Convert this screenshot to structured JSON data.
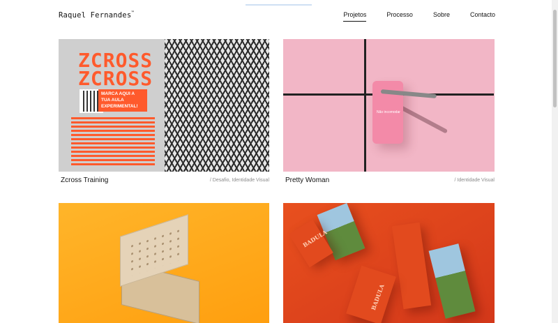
{
  "header": {
    "logo": "Raquel Fernandes",
    "logo_mark": "™",
    "nav": [
      {
        "label": "Projetos",
        "active": true
      },
      {
        "label": "Processo",
        "active": false
      },
      {
        "label": "Sobre",
        "active": false
      },
      {
        "label": "Contacto",
        "active": false
      }
    ]
  },
  "projects": [
    {
      "title": "Zcross Training",
      "tags": "/ Desafio, Identidade Visual",
      "image_text": {
        "word": "ZCROSS",
        "banner": "MARCA AQUI A TUA AULA EXPERIMENTAL!"
      }
    },
    {
      "title": "Pretty Woman",
      "tags": "/ Identidade Visual",
      "image_text": {
        "door_tag": "Não incomodar"
      }
    },
    {
      "title": "",
      "tags": "",
      "image_text": {}
    },
    {
      "title": "",
      "tags": "",
      "image_text": {
        "brand": "BADULA"
      }
    }
  ],
  "colors": {
    "accent_orange": "#ff5a2c",
    "pink": "#f2b6c6",
    "yellow": "#ffb52a",
    "red_orange": "#e8501e"
  }
}
